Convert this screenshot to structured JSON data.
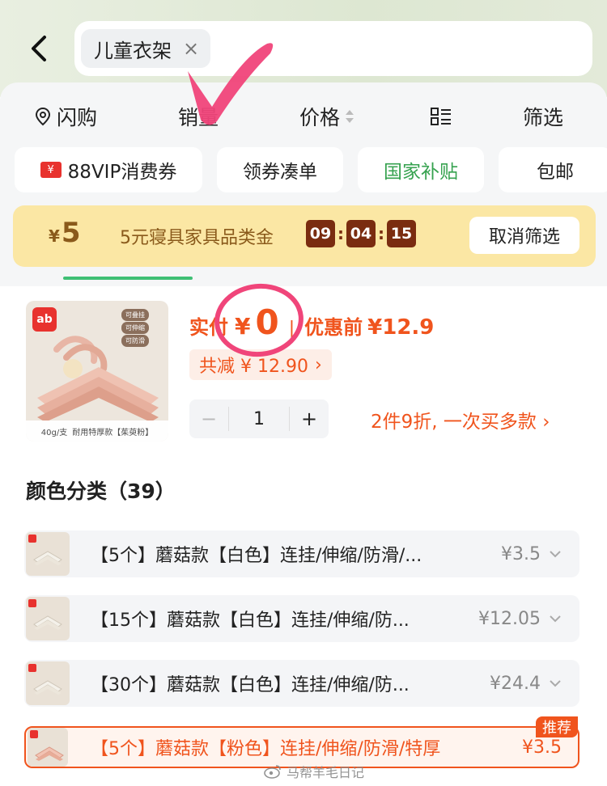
{
  "search": {
    "query": "儿童衣架",
    "clear_symbol": "×"
  },
  "sort_bar": {
    "shanguo": "闪购",
    "sales": "销量",
    "price": "价格",
    "filter": "筛选"
  },
  "tags": {
    "vip_icon_text": "¥",
    "vip": "88VIP消费券",
    "coupon": "领券凑单",
    "national": "国家补贴",
    "freeship": "包邮"
  },
  "coupon_banner": {
    "yen": "¥",
    "amount": "5",
    "text": "5元寝具家具品类金",
    "timer_h": "09",
    "timer_m": "04",
    "timer_s": "15",
    "timer_sep": ":",
    "cancel": "取消筛选"
  },
  "product": {
    "image_caption_weight": "40g/支",
    "image_caption_type": "耐用特厚款【茱萸粉】",
    "image_features": [
      "可叠挂",
      "可伸缩",
      "可防滑"
    ],
    "brand_logo_text": "ab",
    "actual_label": "实付",
    "yen": "¥",
    "actual_price": "0",
    "divider": "|",
    "before_label": "优惠前",
    "before_price": "¥12.9",
    "discount_text": "共减 ¥ 12.90",
    "discount_arrow": "›",
    "quantity": "1",
    "minus": "−",
    "plus": "+",
    "multi_offer": "2件9折, 一次买多款 ›"
  },
  "variants_section": {
    "title": "颜色分类（39）",
    "items": [
      {
        "name": "【5个】蘑菇款【白色】连挂/伸缩/防滑/...",
        "price": "¥3.5"
      },
      {
        "name": "【15个】蘑菇款【白色】连挂/伸缩/防...",
        "price": "¥12.05"
      },
      {
        "name": "【30个】蘑菇款【白色】连挂/伸缩/防...",
        "price": "¥24.4"
      },
      {
        "name": "【5个】蘑菇款【粉色】连挂/伸缩/防滑/特厚",
        "price": "¥3.5",
        "badge": "推荐"
      }
    ]
  },
  "watermark": "马帮羊毛日记",
  "colors": {
    "accent_orange": "#f0541d",
    "green": "#36a24f",
    "banner_yellow": "#fbe7a4",
    "timer_brown": "#7a2c10",
    "annotation_pink": "#f0457a"
  },
  "icons": [
    "back-arrow-icon",
    "location-pin-icon",
    "sort-arrows-icon",
    "list-layout-icon",
    "vip-coupon-icon",
    "chevron-down-icon",
    "weibo-icon"
  ]
}
